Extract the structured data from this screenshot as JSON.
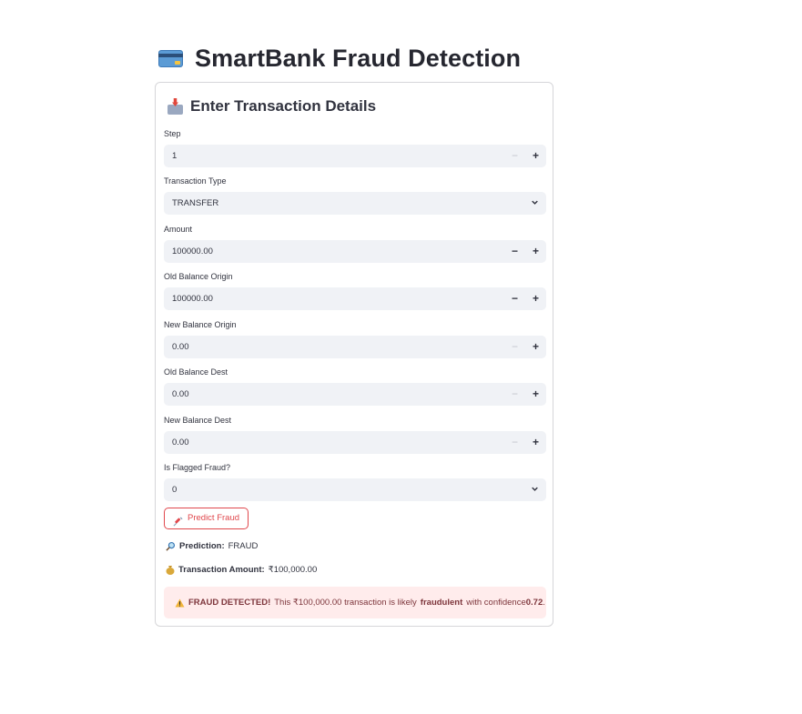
{
  "header": {
    "title": "SmartBank Fraud Detection",
    "icon": "credit-card-icon"
  },
  "form": {
    "heading": "Enter Transaction Details",
    "heading_icon": "inbox-tray-icon",
    "step": {
      "label": "Step",
      "value": "1"
    },
    "transaction_type": {
      "label": "Transaction Type",
      "value": "TRANSFER"
    },
    "amount": {
      "label": "Amount",
      "value": "100000.00"
    },
    "old_balance_origin": {
      "label": "Old Balance Origin",
      "value": "100000.00"
    },
    "new_balance_origin": {
      "label": "New Balance Origin",
      "value": "0.00"
    },
    "old_balance_dest": {
      "label": "Old Balance Dest",
      "value": "0.00"
    },
    "new_balance_dest": {
      "label": "New Balance Dest",
      "value": "0.00"
    },
    "is_flagged_fraud": {
      "label": "Is Flagged Fraud?",
      "value": "0"
    },
    "stepper_minus": "−",
    "stepper_plus": "+"
  },
  "predict_button": {
    "label": "Predict Fraud",
    "icon": "syringe-icon"
  },
  "result": {
    "prediction_label": "Prediction:",
    "prediction_value": "FRAUD",
    "amount_label": "Transaction Amount:",
    "amount_value": "₹100,000.00"
  },
  "alert": {
    "icon": "warning-icon",
    "strong": "FRAUD DETECTED!",
    "text1": "This ₹100,000.00 transaction is likely",
    "strong2": "fraudulent",
    "text2": "with confidence",
    "confidence": "0.72",
    "end": "."
  },
  "colors": {
    "accent": "#e0474c",
    "alert_bg": "#ffecec",
    "input_bg": "#f0f2f6"
  }
}
